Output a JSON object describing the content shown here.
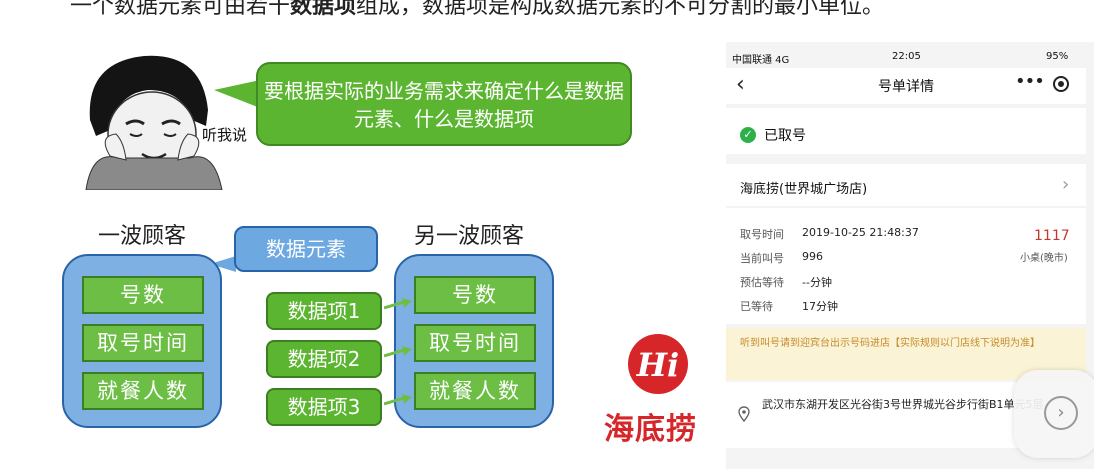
{
  "slide": {
    "top_line_pre": "一个数据元素可由若干",
    "top_line_bold": "数据项",
    "top_line_post": "组成，数据项是构成数据元素的不可分割的最小单位。",
    "listen_label": "听我说",
    "bubble_text": "要根据实际的业务需求来确定什么是数据元素、什么是数据项",
    "group1_title": "一波顾客",
    "group2_title": "另一波顾客",
    "element_label": "数据元素",
    "group1_cells": [
      "号数",
      "取号时间",
      "就餐人数"
    ],
    "group2_cells": [
      "号数",
      "取号时间",
      "就餐人数"
    ],
    "item_labels": [
      "数据项1",
      "数据项2",
      "数据项3"
    ],
    "logo_text": "海底捞",
    "colors": {
      "green": "#5cb531",
      "blue": "#7fb0e3",
      "logo_red": "#d6262a"
    }
  },
  "phone": {
    "status": {
      "carrier": "中国联通 4G",
      "time": "22:05",
      "battery": "95%"
    },
    "nav": {
      "back_icon": "chevron-left-icon",
      "title": "号单详情",
      "more": "•••",
      "target_icon": "target-icon"
    },
    "state_text": "已取号",
    "shop": "海底捞(世界城广场店)",
    "fields": [
      {
        "key": "取号时间",
        "value": "2019-10-25 21:48:37"
      },
      {
        "key": "当前叫号",
        "value": "996"
      },
      {
        "key": "预估等待",
        "value": "--分钟"
      },
      {
        "key": "已等待",
        "value": "17分钟"
      }
    ],
    "queue_number": "1117",
    "queue_type": "小桌(晚市)",
    "notice": "听到叫号请到迎宾台出示号码进店【实际规则以门店线下说明为准】",
    "address": "武汉市东湖开发区光谷街3号世界城光谷步行街B1单元5层"
  }
}
